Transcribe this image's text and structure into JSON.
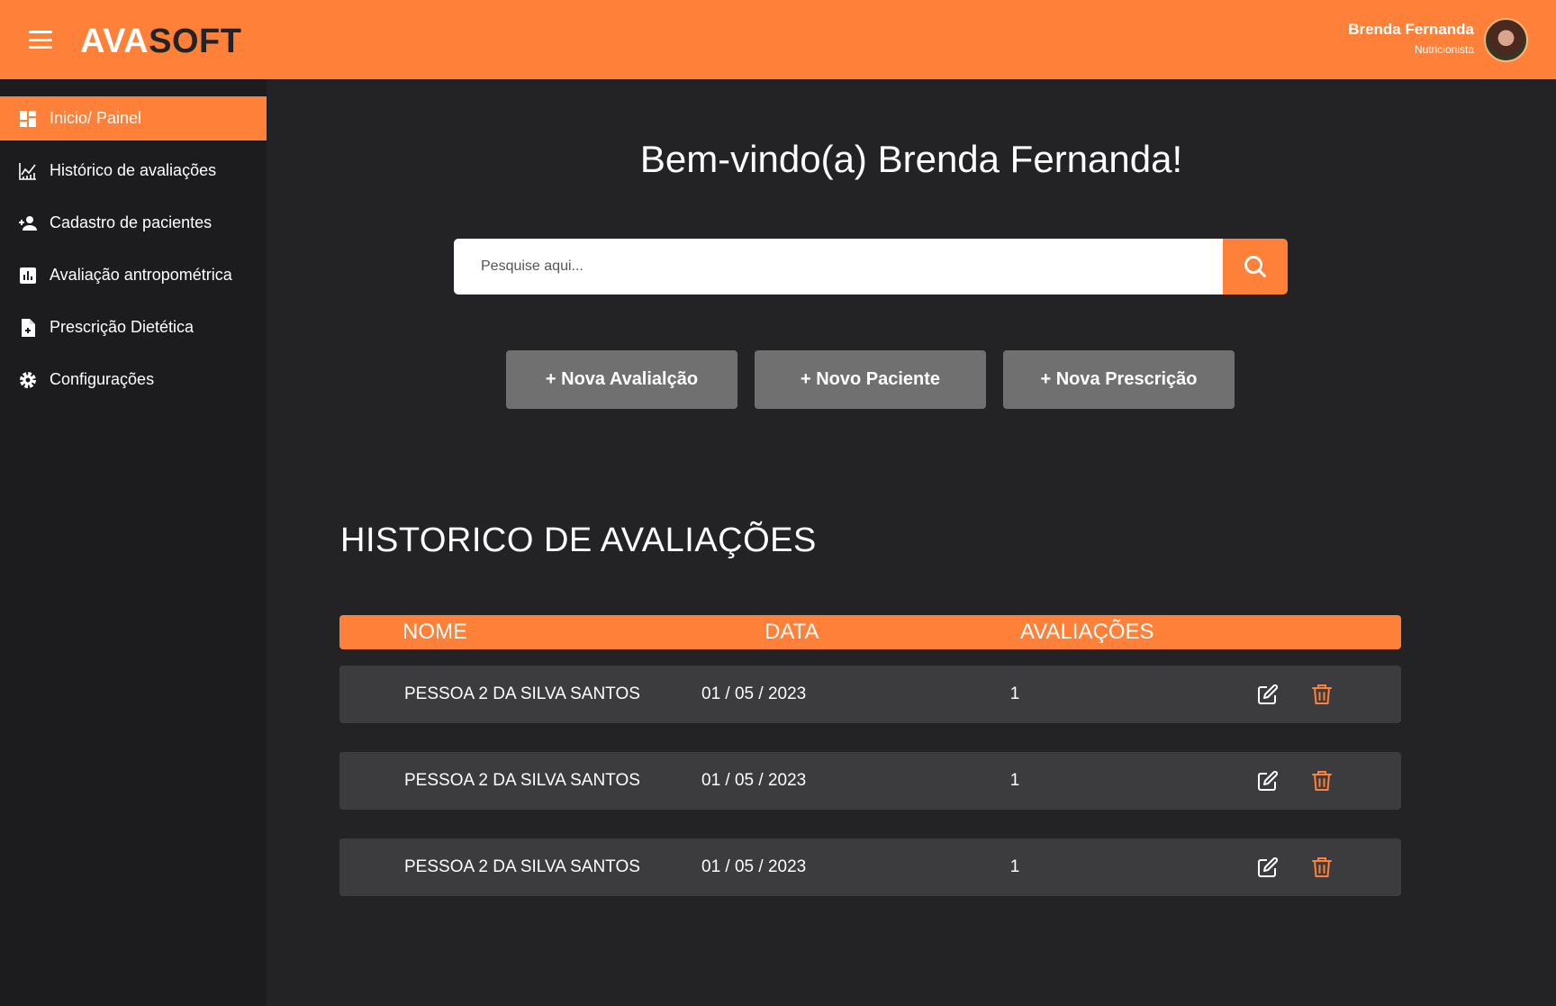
{
  "header": {
    "logo_part1": "AVA",
    "logo_part2": "SOFT",
    "user_name": "Brenda Fernanda",
    "user_role": "Nutricionista"
  },
  "sidebar": {
    "items": [
      {
        "label": "Inicio/ Painel",
        "icon": "dashboard-icon",
        "active": true
      },
      {
        "label": "Histórico de avaliações",
        "icon": "line-chart-icon"
      },
      {
        "label": "Cadastro de pacientes",
        "icon": "add-person-icon"
      },
      {
        "label": "Avaliação antropométrica",
        "icon": "bar-chart-icon"
      },
      {
        "label": "Prescrição Dietética",
        "icon": "add-document-icon"
      },
      {
        "label": "Configurações",
        "icon": "gear-icon"
      }
    ]
  },
  "main": {
    "welcome": "Bem-vindo(a) Brenda Fernanda!",
    "search_placeholder": "Pesquise aqui...",
    "actions": [
      "+ Nova Avalialção",
      "+ Novo Paciente",
      "+ Nova Prescrição"
    ],
    "section_title": "HISTORICO DE AVALIAÇÕES",
    "table": {
      "headers": [
        "NOME",
        "DATA",
        "AVALIAÇÕES"
      ],
      "rows": [
        {
          "name": "PESSOA 2 DA SILVA SANTOS",
          "date": "01 / 05 / 2023",
          "count": "1"
        },
        {
          "name": "PESSOA 2 DA SILVA SANTOS",
          "date": "01 / 05 / 2023",
          "count": "1"
        },
        {
          "name": "PESSOA 2 DA SILVA SANTOS",
          "date": "01 / 05 / 2023",
          "count": "1"
        }
      ]
    }
  },
  "colors": {
    "accent": "#FF8139",
    "background": "#232325",
    "sidebar": "#1C1C1E",
    "row": "#3C3C3E",
    "button": "#707070"
  }
}
